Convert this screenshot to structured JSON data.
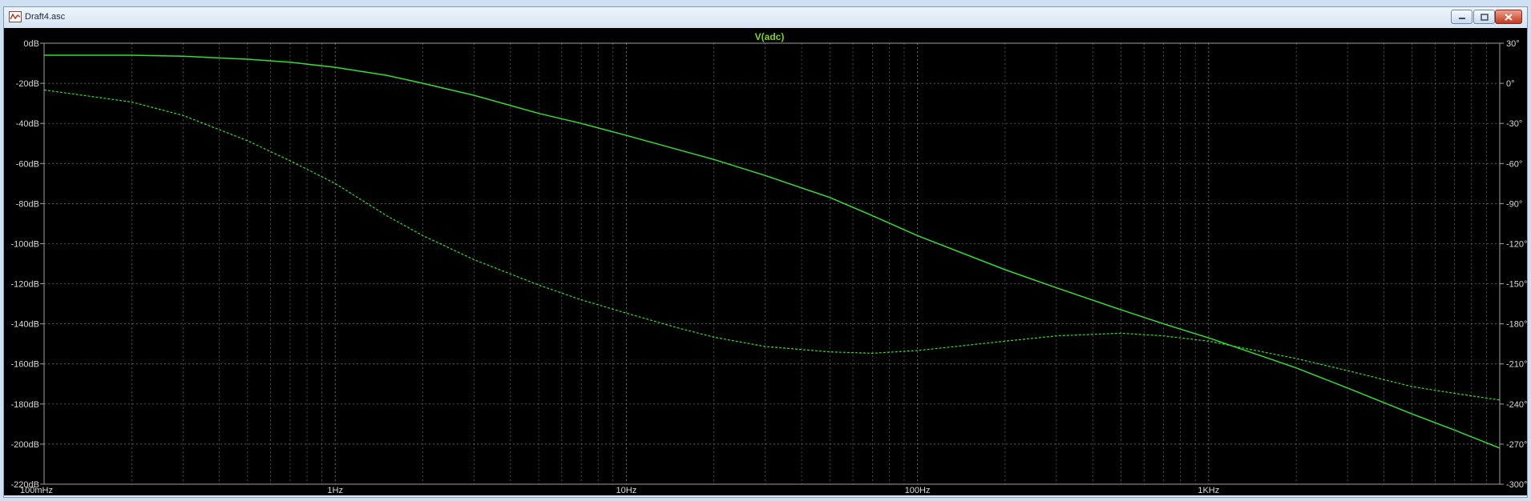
{
  "window": {
    "title": "Draft4.asc",
    "icon": "waveform-icon",
    "controls": [
      "minimize-icon",
      "maximize-icon",
      "close-icon"
    ]
  },
  "colors": {
    "background": "#000000",
    "grid": "#7a7a7a",
    "trace": "#33dd33",
    "title": "#7cd62a",
    "tick_text": "#d8d8d8"
  },
  "chart_data": {
    "type": "line",
    "title": "V(adc)",
    "x_scale": "log",
    "xlim": [
      0.1,
      10000
    ],
    "x_ticks": [
      {
        "value": 0.1,
        "label": "100mHz"
      },
      {
        "value": 1,
        "label": "1Hz"
      },
      {
        "value": 10,
        "label": "10Hz"
      },
      {
        "value": 100,
        "label": "100Hz"
      },
      {
        "value": 1000,
        "label": "1KHz"
      }
    ],
    "y_left": {
      "lim": [
        -220,
        0
      ],
      "ticks": [
        {
          "value": 0,
          "label": "0dB"
        },
        {
          "value": -20,
          "label": "-20dB"
        },
        {
          "value": -40,
          "label": "-40dB"
        },
        {
          "value": -60,
          "label": "-60dB"
        },
        {
          "value": -80,
          "label": "-80dB"
        },
        {
          "value": -100,
          "label": "-100dB"
        },
        {
          "value": -120,
          "label": "-120dB"
        },
        {
          "value": -140,
          "label": "-140dB"
        },
        {
          "value": -160,
          "label": "-160dB"
        },
        {
          "value": -180,
          "label": "-180dB"
        },
        {
          "value": -200,
          "label": "-200dB"
        },
        {
          "value": -220,
          "label": "-220dB"
        }
      ]
    },
    "y_right": {
      "lim": [
        -300,
        30
      ],
      "ticks": [
        {
          "value": 30,
          "label": "30°"
        },
        {
          "value": 0,
          "label": "0°"
        },
        {
          "value": -30,
          "label": "-30°"
        },
        {
          "value": -60,
          "label": "-60°"
        },
        {
          "value": -90,
          "label": "-90°"
        },
        {
          "value": -120,
          "label": "-120°"
        },
        {
          "value": -150,
          "label": "-150°"
        },
        {
          "value": -180,
          "label": "-180°"
        },
        {
          "value": -210,
          "label": "-210°"
        },
        {
          "value": -240,
          "label": "-240°"
        },
        {
          "value": -270,
          "label": "-270°"
        },
        {
          "value": -300,
          "label": "-300°"
        }
      ]
    },
    "grid": true,
    "series": [
      {
        "axis": "left",
        "style": "solid",
        "x": [
          0.1,
          0.2,
          0.3,
          0.5,
          0.7,
          1,
          1.5,
          2,
          3,
          5,
          7,
          10,
          20,
          30,
          50,
          70,
          100,
          200,
          300,
          500,
          700,
          1000,
          2000,
          3000,
          5000,
          7000,
          10000
        ],
        "y": [
          -6,
          -6,
          -6.5,
          -8,
          -9.5,
          -12,
          -16,
          -20,
          -26,
          -35,
          -40,
          -46,
          -58,
          -66,
          -77,
          -86,
          -96,
          -113,
          -122,
          -133,
          -140,
          -147,
          -162,
          -172,
          -185,
          -193,
          -202
        ]
      },
      {
        "axis": "right",
        "style": "dashed",
        "x": [
          0.1,
          0.2,
          0.3,
          0.5,
          0.7,
          1,
          1.5,
          2,
          3,
          5,
          7,
          10,
          15,
          20,
          30,
          50,
          70,
          100,
          200,
          300,
          500,
          700,
          1000,
          2000,
          3000,
          5000,
          7000,
          10000
        ],
        "y": [
          -5,
          -14,
          -24,
          -43,
          -58,
          -75,
          -99,
          -114,
          -132,
          -151,
          -162,
          -172,
          -183,
          -190,
          -197,
          -201,
          -202,
          -200,
          -193,
          -189,
          -187,
          -189,
          -193,
          -206,
          -215,
          -227,
          -232,
          -237
        ]
      }
    ]
  }
}
